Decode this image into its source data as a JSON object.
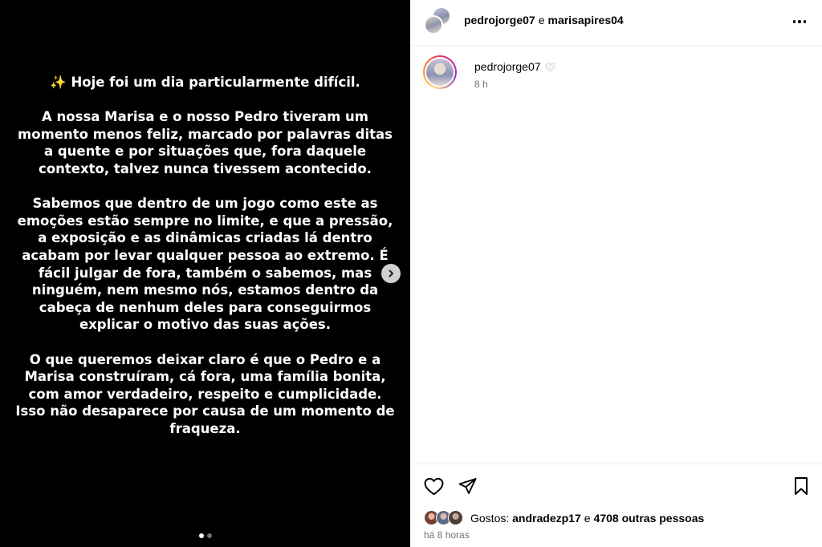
{
  "media": {
    "paragraphs": [
      "✨ Hoje foi um dia particularmente difícil.",
      "A nossa Marisa e o nosso Pedro tiveram um momento menos feliz, marcado por palavras ditas a quente e por situações que, fora daquele contexto, talvez nunca tivessem acontecido.",
      "Sabemos que dentro de um jogo como este as emoções estão sempre no limite, e que a pressão, a exposição e as dinâmicas criadas lá dentro acabam por levar qualquer pessoa ao extremo. É fácil julgar de fora, também o sabemos, mas ninguém, nem mesmo nós, estamos dentro da cabeça de nenhum deles para conseguirmos explicar o motivo das suas ações.",
      "O que queremos deixar claro é que o Pedro e a Marisa construíram, cá fora, uma família bonita, com amor verdadeiro, respeito e cumplicidade. Isso não desaparece por causa de um momento de fraqueza."
    ],
    "carousel": {
      "total": 2,
      "current": 1
    }
  },
  "header": {
    "user1": "pedrojorge07",
    "conjunction": "e",
    "user2": "marisapires04"
  },
  "caption": {
    "username": "pedrojorge07",
    "emoji": "🤍",
    "time": "8 h"
  },
  "footer": {
    "likes_prefix": "Gostos:",
    "liker": "andradezp17",
    "likes_conj": "e",
    "others": "4708 outras pessoas",
    "posted_ago": "há 8 horas"
  },
  "icons": {
    "next": "chevron-right-icon",
    "more": "more-horizontal-icon",
    "like": "heart-icon",
    "share": "paper-plane-icon",
    "save": "bookmark-icon"
  },
  "colors": {
    "media_background": "#000000",
    "secondary_text": "#737373",
    "divider": "#efefef"
  }
}
